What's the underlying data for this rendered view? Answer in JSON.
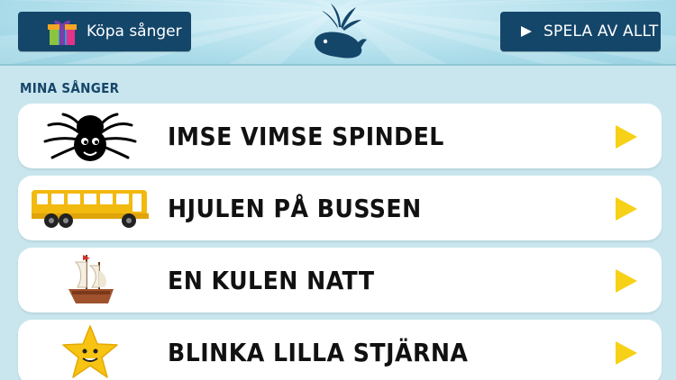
{
  "header": {
    "buy_label": "Köpa sånger",
    "play_all_label": "SPELA AV ALLT"
  },
  "section": {
    "title": "MINA SÅNGER"
  },
  "songs": [
    {
      "title": "IMSE VIMSE SPINDEL",
      "icon": "spider-icon"
    },
    {
      "title": "HJULEN PÅ BUSSEN",
      "icon": "bus-icon"
    },
    {
      "title": "EN KULEN NATT",
      "icon": "ship-icon"
    },
    {
      "title": "BLINKA LILLA STJÄRNA",
      "icon": "star-icon"
    }
  ],
  "colors": {
    "button_bg": "#14466a",
    "play_triangle": "#f7d117",
    "background": "#c9e6ee"
  }
}
